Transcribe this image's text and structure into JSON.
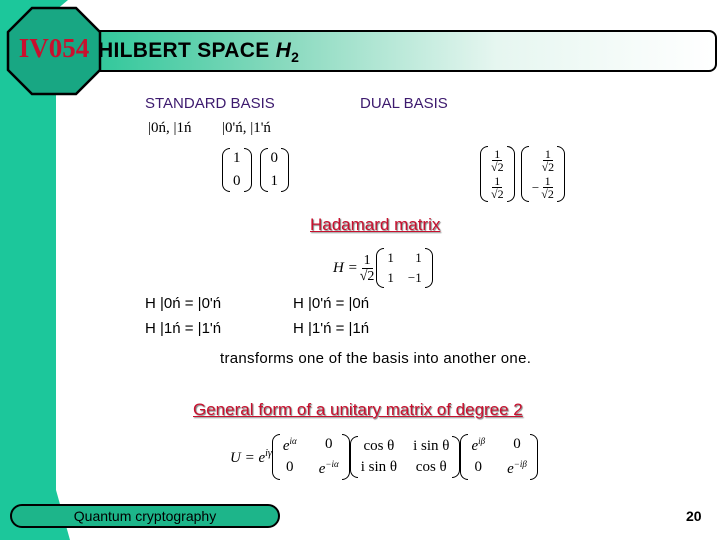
{
  "header": {
    "course_code": "IV054",
    "title_text": "HILBERT SPACE ",
    "title_symbol": "H",
    "title_subscript": "2"
  },
  "bases": {
    "standard_label": "STANDARD BASIS",
    "dual_label": "DUAL BASIS",
    "standard_kets": "|0ń, |1ń",
    "dual_kets": "|0'ń, |1'ń",
    "standard_vectors": [
      [
        "1",
        "0"
      ],
      [
        "0",
        "1"
      ]
    ],
    "dual_vectors": [
      {
        "top": {
          "sign": "",
          "num": "1",
          "den": "√2"
        },
        "bottom": {
          "sign": "",
          "num": "1",
          "den": "√2"
        }
      },
      {
        "top": {
          "sign": "",
          "num": "1",
          "den": "√2"
        },
        "bottom": {
          "sign": "−",
          "num": "1",
          "den": "√2"
        }
      }
    ]
  },
  "hadamard": {
    "heading": "Hadamard matrix",
    "lhs": "H =",
    "factor_num": "1",
    "factor_den": "√2",
    "matrix": [
      [
        "1",
        "1"
      ],
      [
        "1",
        "−1"
      ]
    ],
    "equations": [
      {
        "left": "H |0ń = |0'ń",
        "right": "H |0'ń = |0ń"
      },
      {
        "left": "H |1ń = |1'ń",
        "right": "H |1'ń = |1ń"
      }
    ],
    "note": "transforms one of the basis into another one."
  },
  "unitary": {
    "heading": "General form of a unitary matrix of degree 2",
    "lhs": "U = e",
    "lhs_exp": "iγ",
    "m1": [
      [
        "e^iα",
        "0"
      ],
      [
        "0",
        "e^−iα"
      ]
    ],
    "m2": [
      [
        "cosθ",
        "i sinθ"
      ],
      [
        "i sinθ",
        "cosθ"
      ]
    ],
    "m3": [
      [
        "e^iβ",
        "0"
      ],
      [
        "0",
        "e^−iβ"
      ]
    ],
    "m1_display": {
      "a": "e",
      "a_exp": "iα",
      "b": "0",
      "c": "0",
      "d": "e",
      "d_exp": "−iα"
    },
    "m2_display": {
      "a": "cos θ",
      "b": "i sin θ",
      "c": "i sin θ",
      "d": "cos θ"
    },
    "m3_display": {
      "a": "e",
      "a_exp": "iβ",
      "b": "0",
      "c": "0",
      "d": "e",
      "d_exp": "−iβ"
    }
  },
  "footer": {
    "label": "Quantum cryptography",
    "page_number": "20"
  },
  "colors": {
    "teal": "#1cc79b",
    "octagon": "#18a783",
    "code_red": "#c8102e",
    "heading_purple": "#3d1a6e",
    "link_red": "#c8102e"
  }
}
